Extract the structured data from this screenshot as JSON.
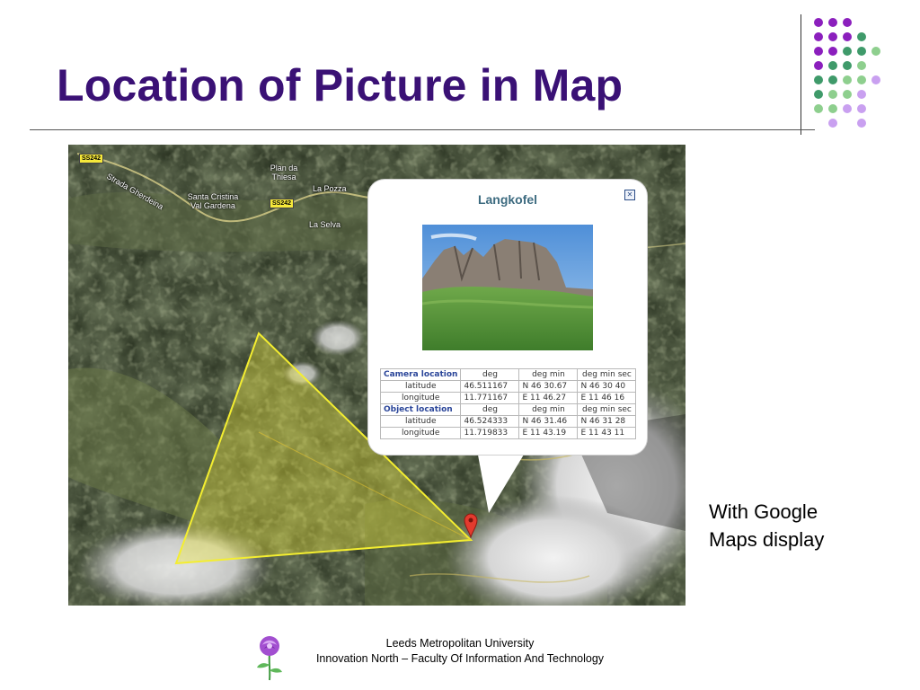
{
  "slide": {
    "title": "Location of Picture in Map",
    "caption_lines": [
      "With Google",
      "Maps display"
    ],
    "footer_lines": [
      "Leeds Metropolitan University",
      "Innovation North – Faculty Of Information And Technology"
    ]
  },
  "map": {
    "labels": [
      "Strada Gherdeina",
      "Plan da Thiesa",
      "La Pozza",
      "Santa Cristina Val Gardena",
      "La Selva"
    ],
    "road_labels": [
      "SS242",
      "SS242"
    ],
    "marker_icon": "map-pin-icon"
  },
  "popup": {
    "title": "Langkofel",
    "close_icon": "close-icon",
    "photo": "mountain-photo",
    "tables": [
      {
        "header": [
          "Camera location",
          "deg",
          "deg min",
          "deg min sec"
        ],
        "rows": [
          [
            "latitude",
            "46.511167",
            "N 46 30.67",
            "N 46 30 40"
          ],
          [
            "longitude",
            "11.771167",
            "E 11 46.27",
            "E 11 46 16"
          ]
        ]
      },
      {
        "header": [
          "Object location",
          "deg",
          "deg min",
          "deg min sec"
        ],
        "rows": [
          [
            "latitude",
            "46.524333",
            "N 46 31.46",
            "N 46 31 28"
          ],
          [
            "longitude",
            "11.719833",
            "E 11 43.19",
            "E 11 43 11"
          ]
        ]
      }
    ]
  },
  "colors": {
    "title": "#3a1175",
    "dot_purple": "#8b1fbd",
    "dot_green": "#3f9a6a",
    "dot_lightgreen": "#8ecf8e",
    "dot_lavender": "#c9a0f0",
    "view_cone": "#f0ea3c"
  }
}
